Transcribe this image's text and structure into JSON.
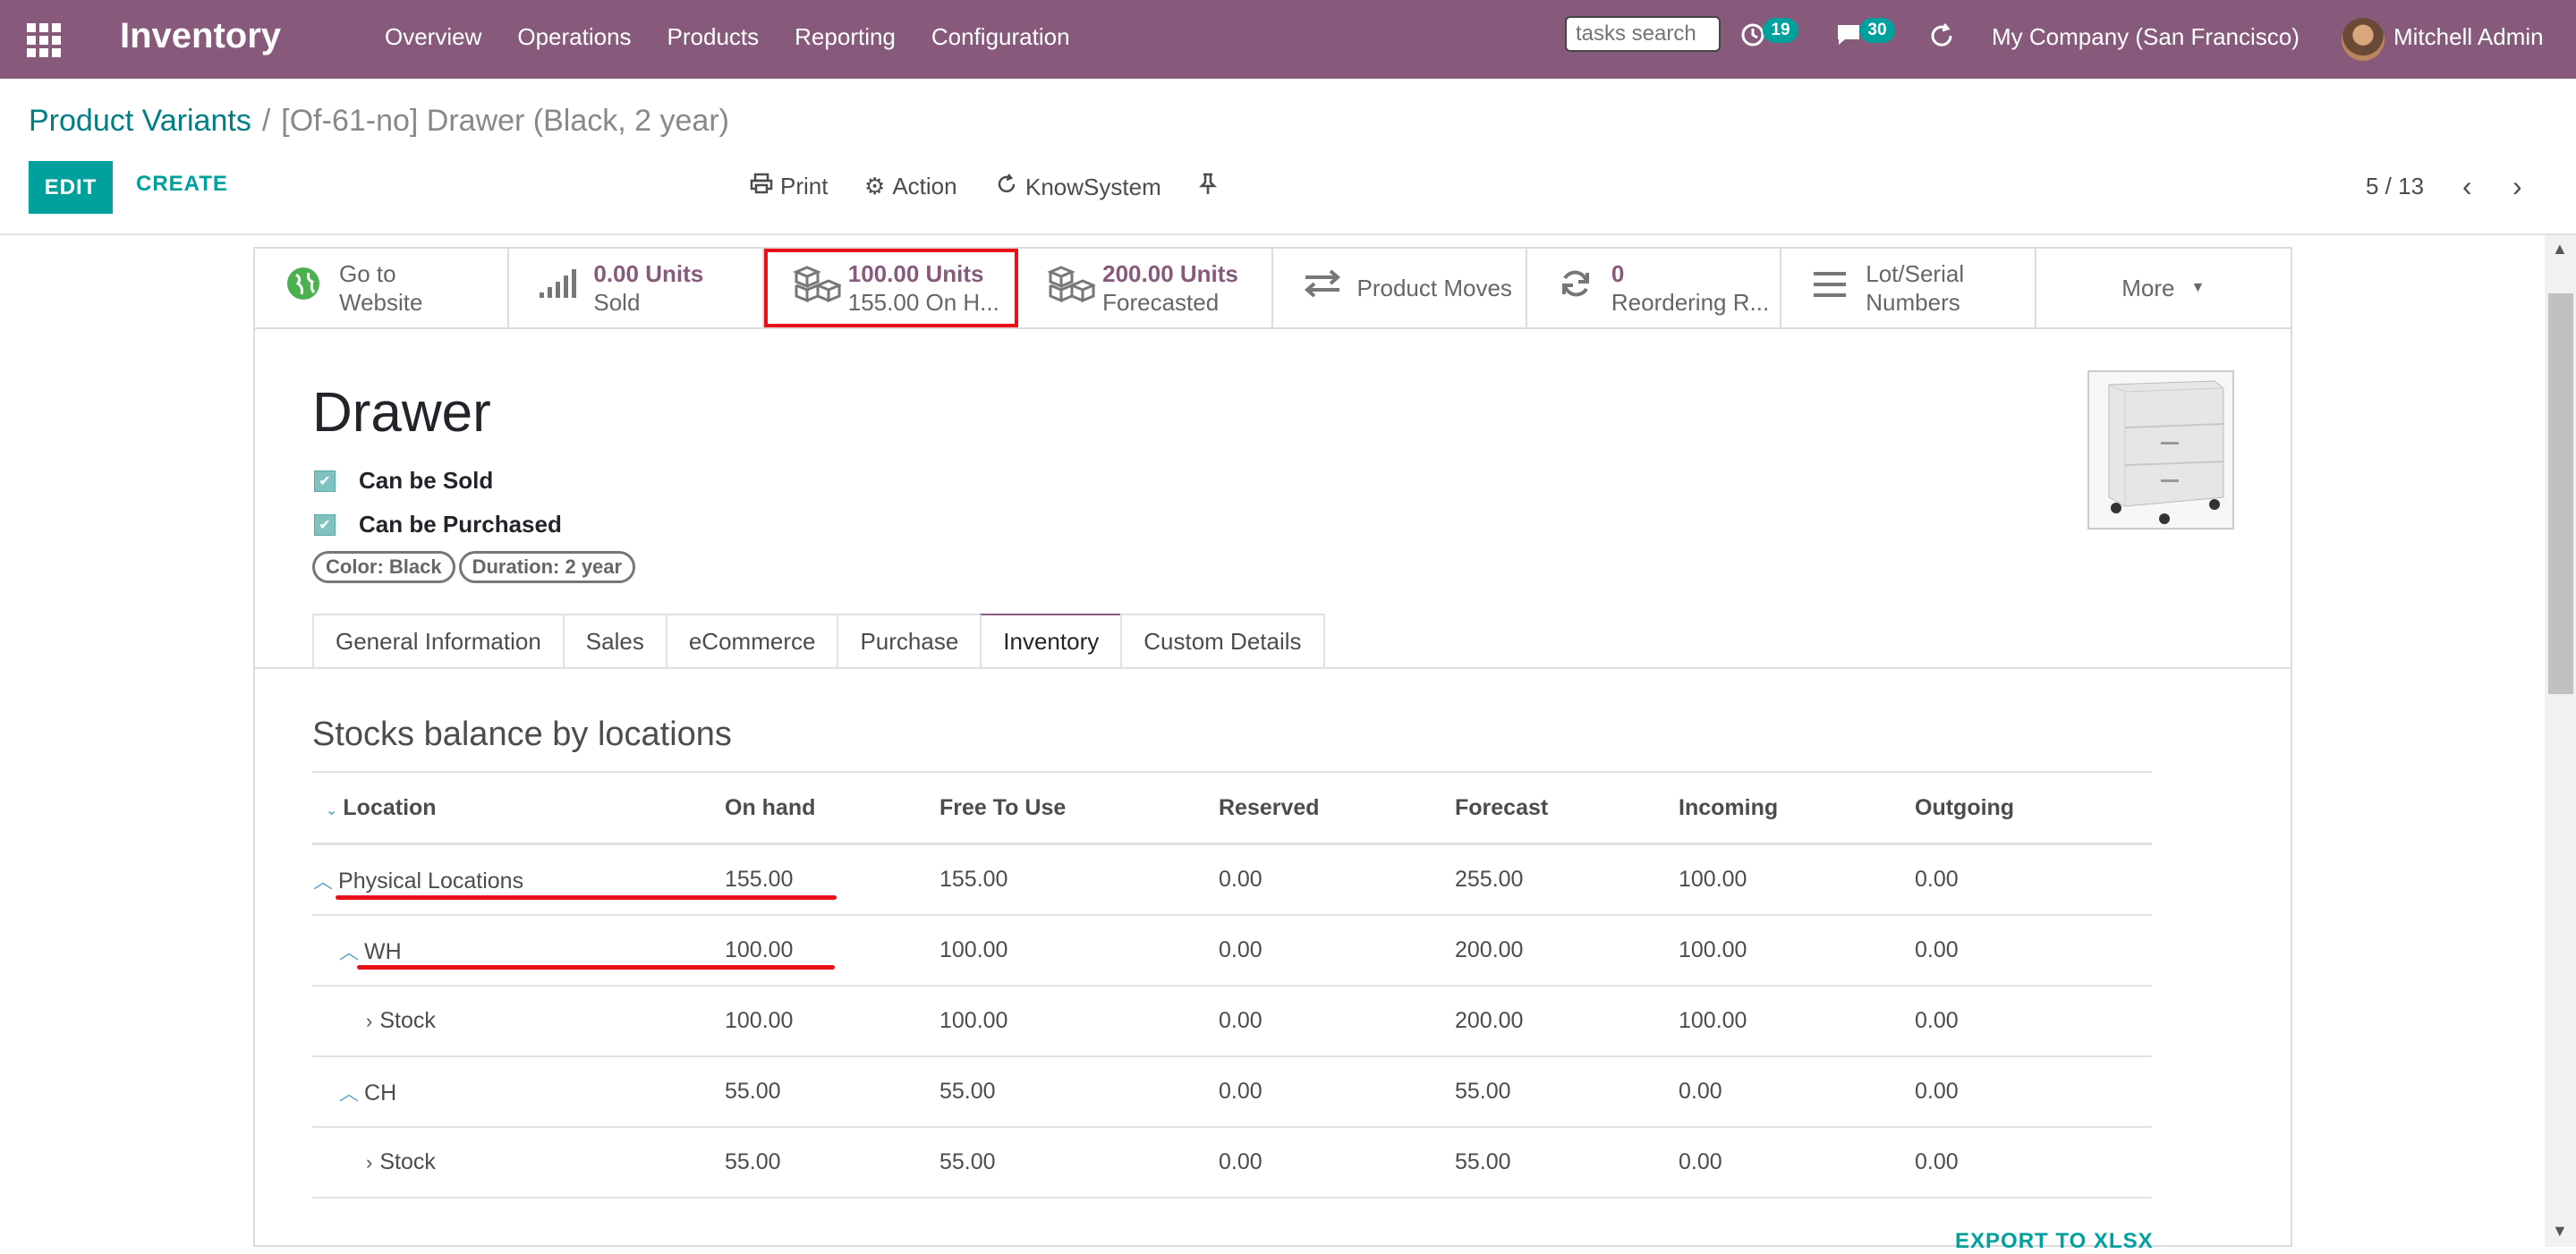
{
  "navbar": {
    "app_name": "Inventory",
    "menu": [
      "Overview",
      "Operations",
      "Products",
      "Reporting",
      "Configuration"
    ],
    "search_placeholder": "tasks search",
    "activity_count": "19",
    "messages_count": "30",
    "company": "My Company (San Francisco)",
    "user": "Mitchell Admin",
    "accent_color": "#875a7b"
  },
  "breadcrumb": {
    "parent": "Product Variants",
    "separator": "/",
    "current": "[Of-61-no] Drawer (Black, 2 year)"
  },
  "toolbar": {
    "edit_label": "EDIT",
    "create_label": "CREATE",
    "print_label": "Print",
    "action_label": "Action",
    "knowsystem_label": "KnowSystem",
    "pager": "5 / 13"
  },
  "smart_buttons": [
    {
      "icon": "globe-icon",
      "value": "",
      "label": "Go to",
      "label2": "Website"
    },
    {
      "icon": "signal-icon",
      "value": "0.00 Units",
      "label": "Sold"
    },
    {
      "icon": "cubes-icon",
      "value": "100.00 Units",
      "label": "155.00 On H..."
    },
    {
      "icon": "cubes-icon",
      "value": "200.00 Units",
      "label": "Forecasted"
    },
    {
      "icon": "exchange-icon",
      "value": "",
      "label": "Product Moves"
    },
    {
      "icon": "refresh-icon",
      "value": "0",
      "label": "Reordering R..."
    },
    {
      "icon": "list-icon",
      "value": "",
      "label": "Lot/Serial",
      "label2": "Numbers"
    },
    {
      "icon": "",
      "value": "",
      "label": "More"
    }
  ],
  "product": {
    "name": "Drawer",
    "can_be_sold": "Can be Sold",
    "can_be_purchased": "Can be Purchased",
    "tags": [
      "Color: Black",
      "Duration: 2 year"
    ]
  },
  "tabs": [
    "General Information",
    "Sales",
    "eCommerce",
    "Purchase",
    "Inventory",
    "Custom Details"
  ],
  "active_tab": "Inventory",
  "stock_section": {
    "title": "Stocks balance by locations",
    "columns": [
      "Location",
      "On hand",
      "Free To Use",
      "Reserved",
      "Forecast",
      "Incoming",
      "Outgoing"
    ],
    "rows": [
      {
        "location": "Physical Locations",
        "on_hand": "155.00",
        "free": "155.00",
        "reserved": "0.00",
        "forecast": "255.00",
        "incoming": "100.00",
        "outgoing": "0.00"
      },
      {
        "location": "WH",
        "on_hand": "100.00",
        "free": "100.00",
        "reserved": "0.00",
        "forecast": "200.00",
        "incoming": "100.00",
        "outgoing": "0.00"
      },
      {
        "location": "Stock",
        "on_hand": "100.00",
        "free": "100.00",
        "reserved": "0.00",
        "forecast": "200.00",
        "incoming": "100.00",
        "outgoing": "0.00"
      },
      {
        "location": "CH",
        "on_hand": "55.00",
        "free": "55.00",
        "reserved": "0.00",
        "forecast": "55.00",
        "incoming": "0.00",
        "outgoing": "0.00"
      },
      {
        "location": "Stock",
        "on_hand": "55.00",
        "free": "55.00",
        "reserved": "0.00",
        "forecast": "55.00",
        "incoming": "0.00",
        "outgoing": "0.00"
      }
    ],
    "export_label": "EXPORT TO XLSX"
  }
}
